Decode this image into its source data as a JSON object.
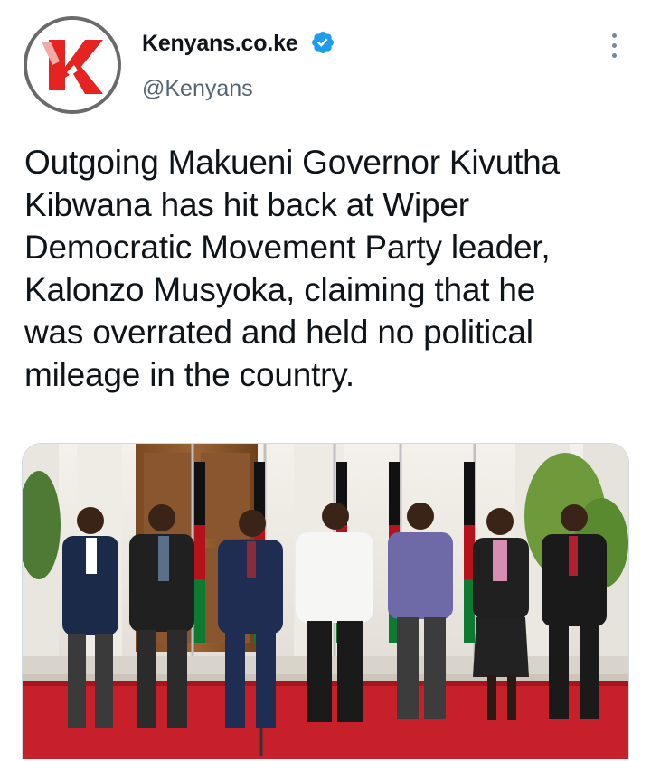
{
  "author": {
    "name": "Kenyans.co.ke",
    "handle": "@Kenyans",
    "verified": true,
    "avatar_icon": "kenyans-k-logo-icon"
  },
  "menu_icon": "more-vertical-icon",
  "tweet": {
    "lines": [
      "Outgoing Makueni Governor Kivutha",
      "Kibwana has hit back at Wiper",
      "Democratic Movement Party leader,",
      "Kalonzo Musyoka,  claiming that he",
      "was overrated and held no political",
      "mileage in the country."
    ]
  },
  "media": {
    "kind": "photo",
    "icon": "photo-image",
    "people_count": 7
  },
  "colors": {
    "verified_blue": "#1d9bf0",
    "logo_red": "#e52421",
    "handle_gray": "#536471",
    "carpet_red": "#c8202a"
  }
}
